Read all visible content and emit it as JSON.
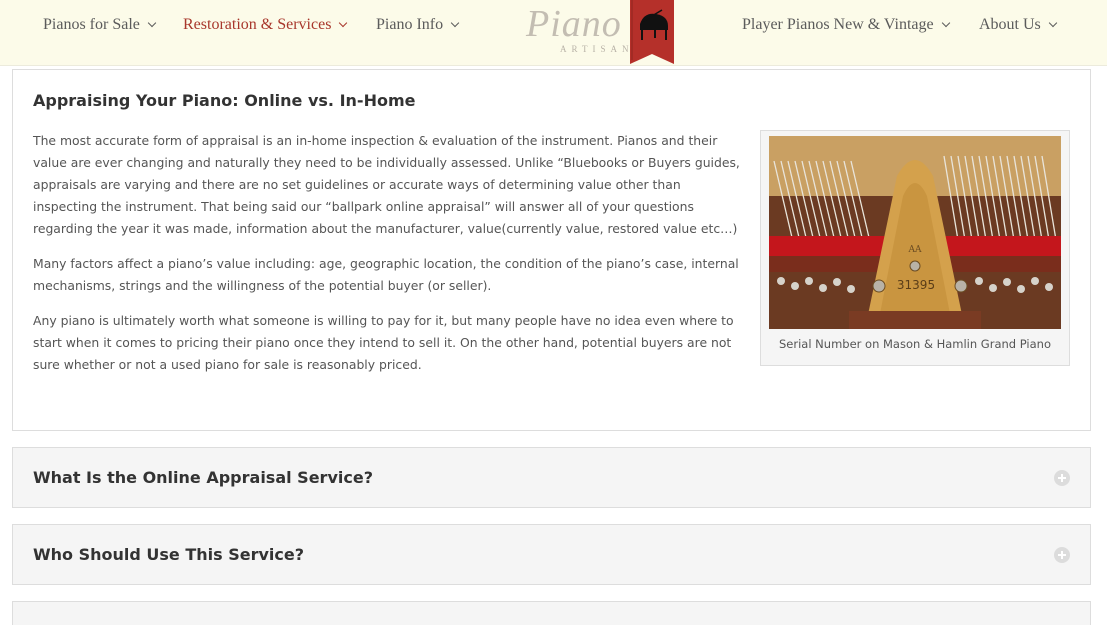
{
  "nav": {
    "items": [
      {
        "label": "Pianos for Sale"
      },
      {
        "label": "Restoration & Services"
      },
      {
        "label": "Piano Info"
      },
      {
        "label": "Player Pianos New & Vintage"
      },
      {
        "label": "About Us"
      }
    ],
    "active_color": "#a8372c",
    "logo": {
      "word": "Piano",
      "sub": "ARTISANS"
    }
  },
  "section": {
    "title": "Appraising Your Piano: Online vs. In-Home",
    "paragraphs": [
      "The most accurate form of appraisal is an in-home inspection & evaluation of the instrument. Pianos and their value are ever changing and naturally they need to be individually assessed. Unlike “Bluebooks or Buyers guides, appraisals are varying and there are no set guidelines or accurate ways of determining value other than inspecting the instrument. That being said our “ballpark online appraisal” will answer all of your questions regarding the year it was made, information about the manufacturer, value(currently value, restored value etc…)",
      "Many factors affect a piano’s value including: age, geographic location, the condition of the piano’s case, internal mechanisms, strings and the willingness of the potential buyer (or seller).",
      "Any piano is ultimately worth what someone is willing to pay for it, but many people have no idea even where to start when it comes to pricing their piano once they intend to sell it. On the other hand, potential buyers are not sure whether or not a used piano for sale is reasonably priced."
    ],
    "figure": {
      "plate_letters": "AA",
      "serial": "31395",
      "caption": "Serial Number on Mason & Hamlin Grand Piano"
    }
  },
  "accordion": [
    {
      "title": "What Is the Online Appraisal Service?"
    },
    {
      "title": "Who Should Use This Service?"
    },
    {
      "title": ""
    }
  ]
}
